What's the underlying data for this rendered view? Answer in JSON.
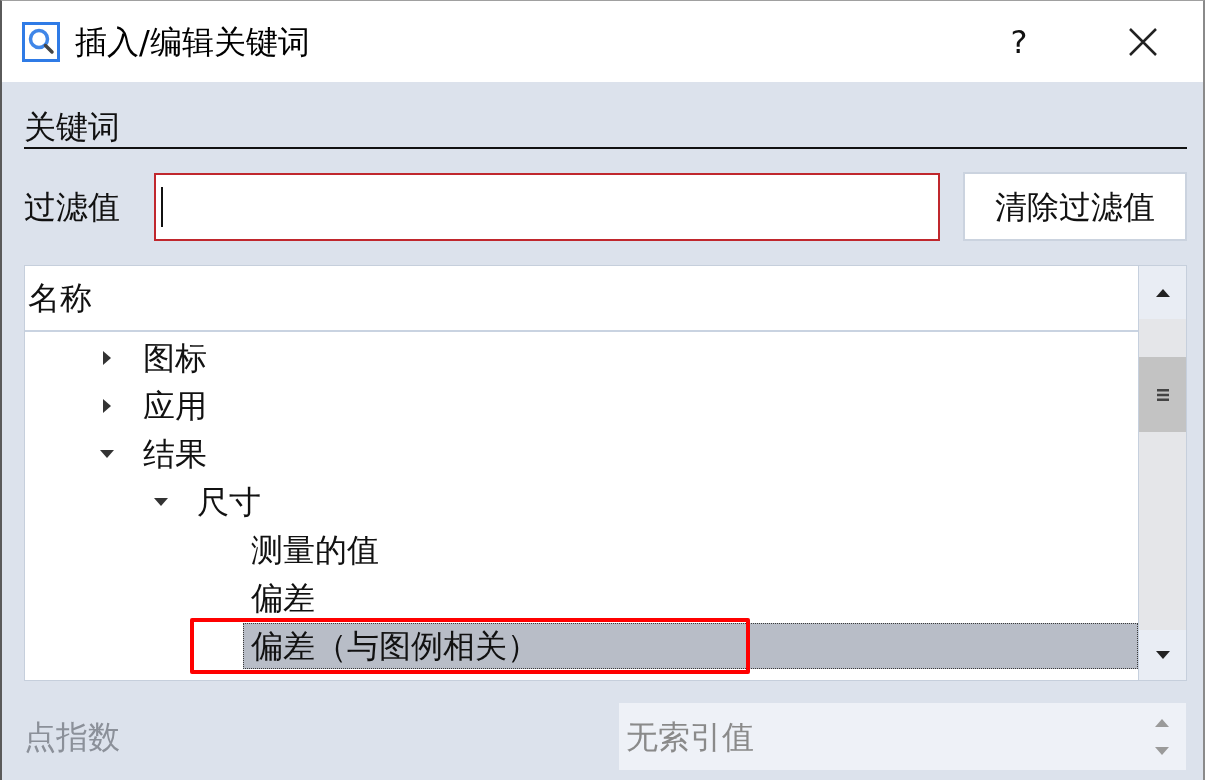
{
  "window": {
    "title": "插入/编辑关键词",
    "help_button": "?"
  },
  "keywords_section": {
    "heading": "关键词"
  },
  "filter": {
    "label": "过滤值",
    "focused": true,
    "clear_button": "清除过滤值"
  },
  "tree": {
    "columns": [
      "名称"
    ],
    "items": [
      {
        "label": "图标",
        "expanded": false,
        "selected": false,
        "highlighted": false
      },
      {
        "label": "应用",
        "expanded": false,
        "selected": false,
        "highlighted": false
      },
      {
        "label": "结果",
        "expanded": true,
        "selected": false,
        "highlighted": false,
        "children": [
          {
            "label": "尺寸",
            "expanded": true,
            "selected": false,
            "highlighted": false,
            "children": [
              {
                "label": "测量的值",
                "selected": false,
                "highlighted": false
              },
              {
                "label": "偏差",
                "selected": false,
                "highlighted": false
              },
              {
                "label": "偏差（与图例相关）",
                "selected": true,
                "highlighted": true
              }
            ]
          }
        ]
      }
    ]
  },
  "point_index": {
    "label": "点指数",
    "value": "无索引值",
    "disabled": true
  }
}
